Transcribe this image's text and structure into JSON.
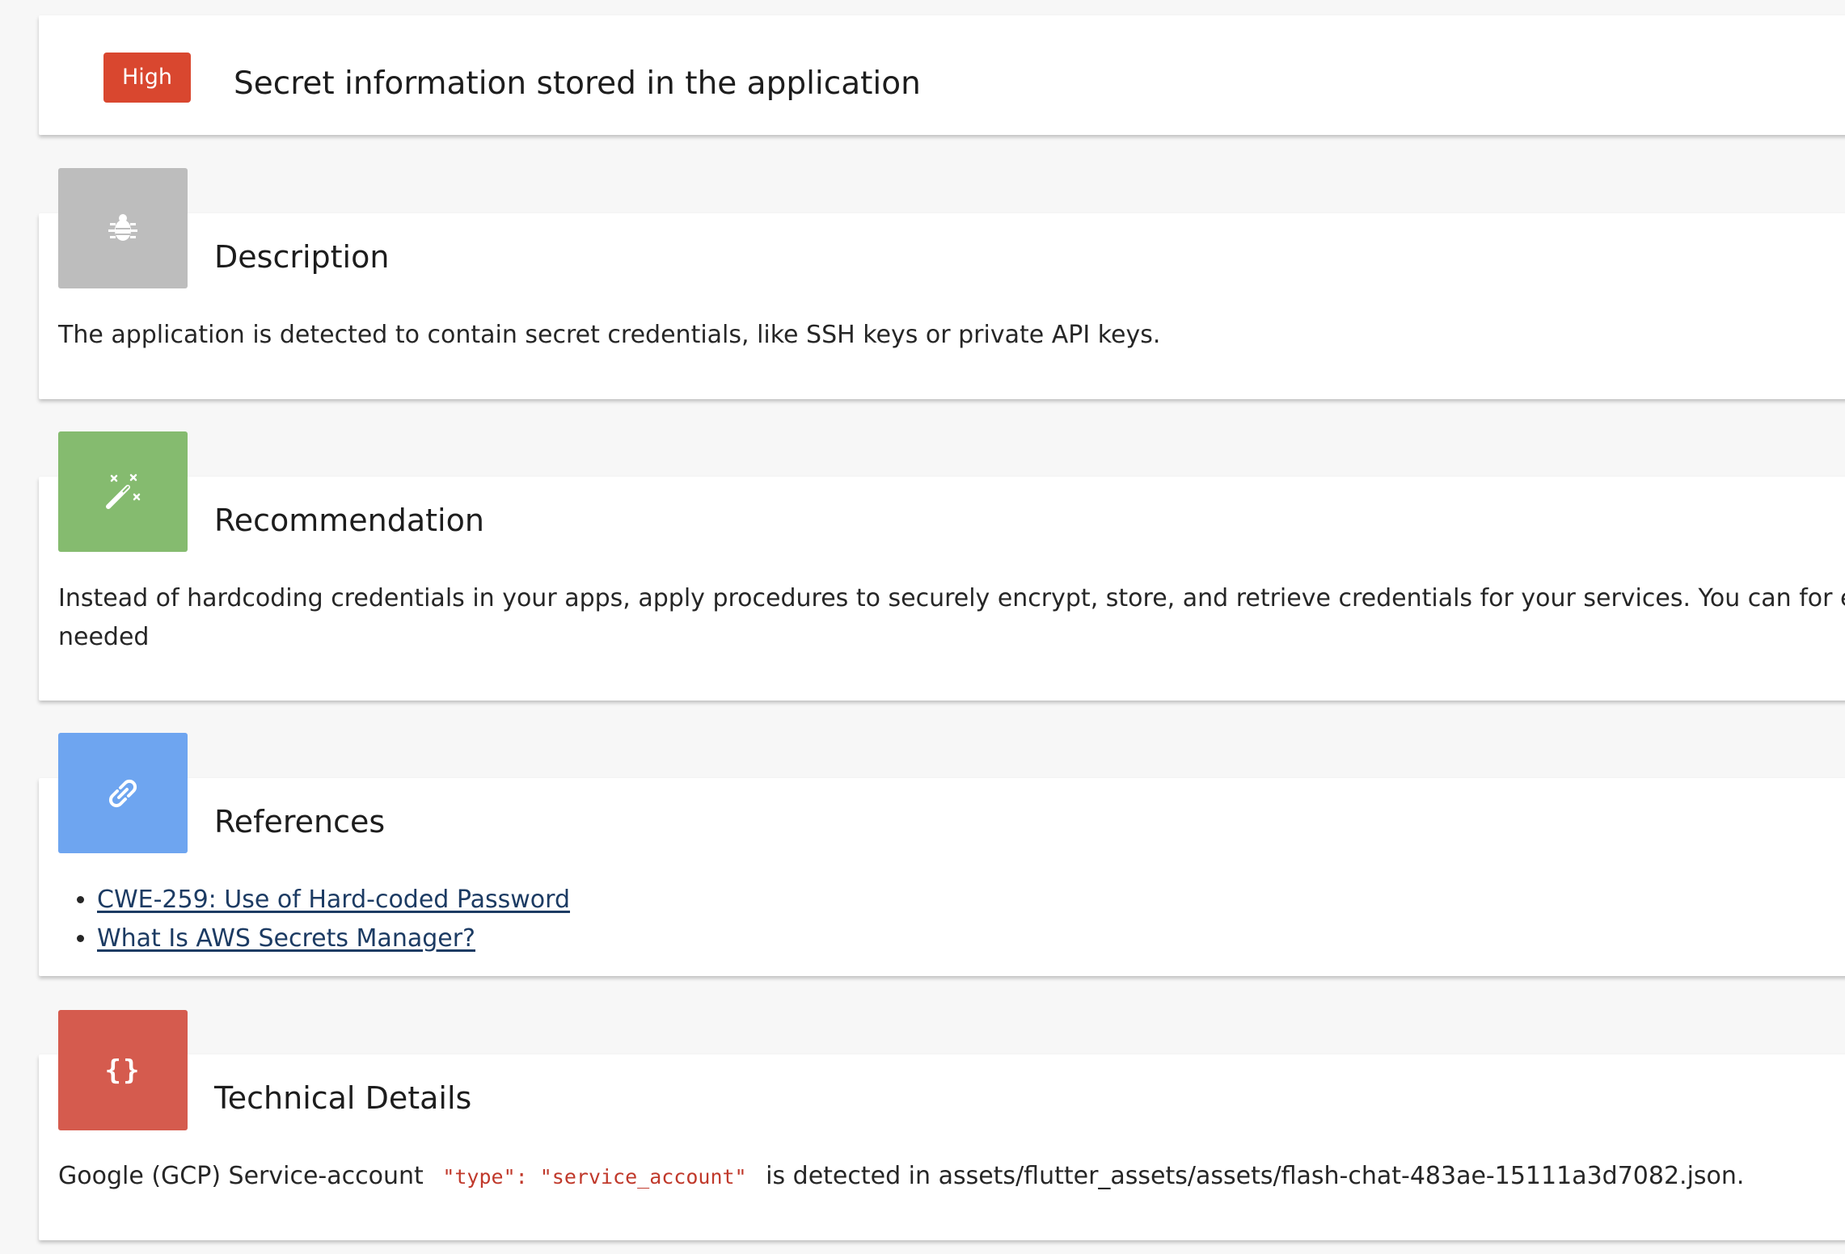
{
  "issue": {
    "severity": "High",
    "title": "Secret information stored in the application"
  },
  "description": {
    "title": "Description",
    "text": "The application is detected to contain secret credentials, like SSH keys or private API keys."
  },
  "recommendation": {
    "title": "Recommendation",
    "line1": "Instead of hardcoding credentials in your apps, apply procedures to securely encrypt, store, and retrieve credentials for your services. You can for exar",
    "line2": "needed"
  },
  "references": {
    "title": "References",
    "links": [
      "CWE-259: Use of Hard-coded Password",
      "What Is AWS Secrets Manager?"
    ]
  },
  "technical": {
    "title": "Technical Details",
    "text_before": "Google (GCP) Service-account",
    "code": "\"type\": \"service_account\"",
    "text_after": "is detected in assets/flutter_assets/assets/flash-chat-483ae-15111a3d7082.json."
  },
  "colors": {
    "severity_high": "#d9472f",
    "description_icon": "#bdbdbd",
    "recommendation_icon": "#85bb6f",
    "references_icon": "#6ea5f0",
    "technical_icon": "#d55b4e",
    "link": "#1c3b63",
    "code": "#c0392b"
  },
  "icons": {
    "description": "bug-icon",
    "recommendation": "magic-wand-icon",
    "references": "link-icon",
    "technical": "braces-icon"
  }
}
